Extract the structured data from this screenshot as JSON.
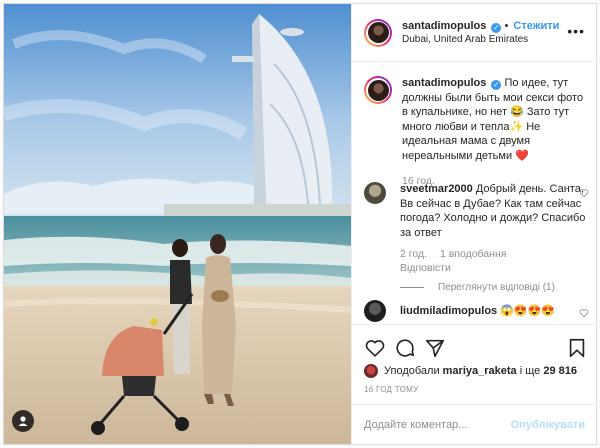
{
  "header": {
    "username": "santadimopulos",
    "follow_label": "Стежити",
    "location": "Dubai, United Arab Emirates",
    "more_icon": "more-horizontal-icon"
  },
  "caption": {
    "username": "santadimopulos",
    "text": "По идее, тут должны были быть мои секси фото в купальнике, но нет 😂 Зато тут много любви и тепла✨ Не идеальная мама с двумя нереальными детьми ❤️",
    "time": "16 год."
  },
  "comments": [
    {
      "username": "sveetmar2000",
      "text": "Добрый день. Санта, Вв сейчас в Дубае? Как там сейчас погода? Холодно и дожди? Спасибо за ответ",
      "time": "2 год.",
      "likes": "1 вподобання",
      "reply_label": "Відповісти",
      "view_replies": "Переглянути відповіді (1)"
    },
    {
      "username": "liudmiladimopulos",
      "text": "😱😍😍😍"
    }
  ],
  "actions": {
    "like_icon": "heart-icon",
    "comment_icon": "comment-icon",
    "share_icon": "share-icon",
    "save_icon": "bookmark-icon"
  },
  "likes": {
    "prefix": "Уподобали",
    "user": "mariya_raketa",
    "suffix": "і ще",
    "count": "29 816"
  },
  "post_time": "16 ГОД ТОМУ",
  "add_comment": {
    "placeholder": "Додайте коментар...",
    "post_label": "Опублікувати"
  },
  "colors": {
    "accent": "#3897f0",
    "muted": "#8e8e8e",
    "heart": "#ed4956",
    "post_disabled": "#b2dffc"
  }
}
